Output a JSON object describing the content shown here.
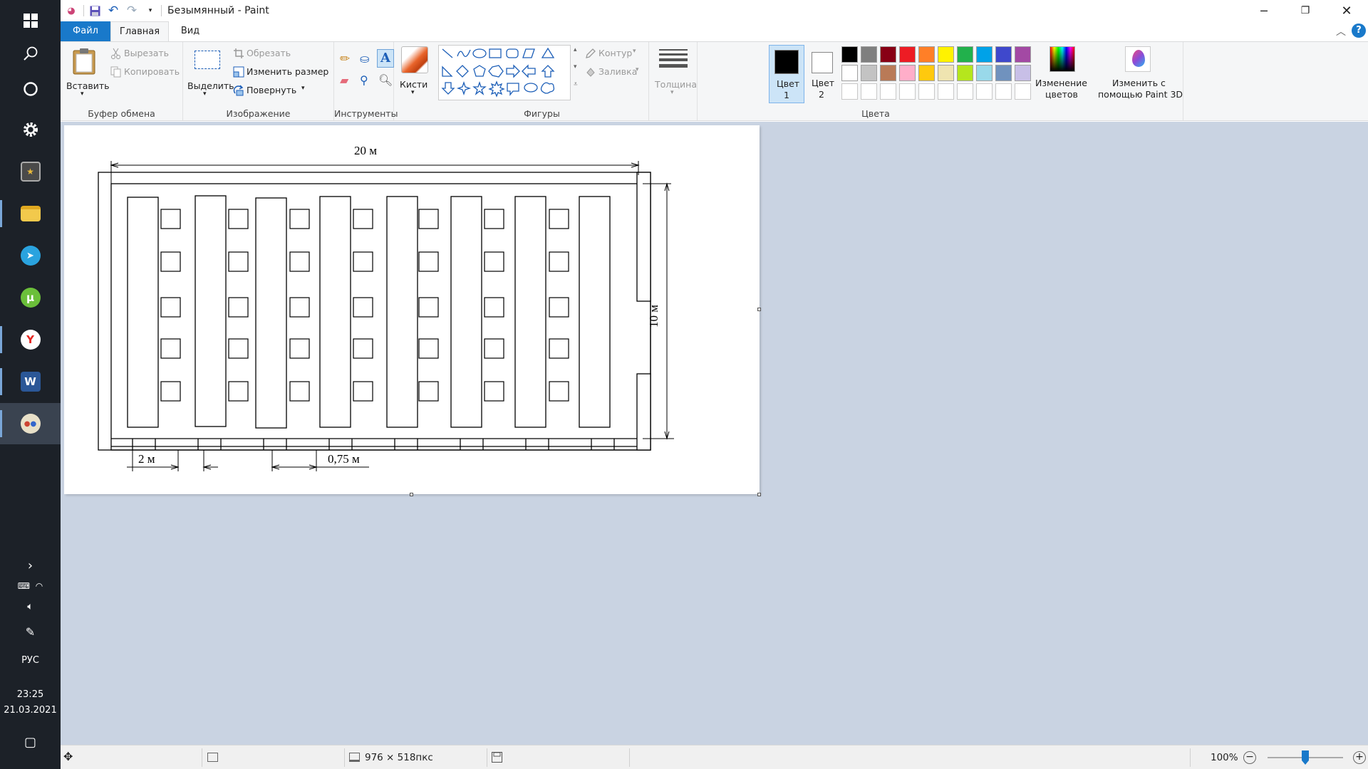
{
  "window": {
    "title": "Безымянный - Paint"
  },
  "tabs": {
    "file": "Файл",
    "home": "Главная",
    "view": "Вид"
  },
  "clipboard": {
    "paste": "Вставить",
    "cut": "Вырезать",
    "copy": "Копировать",
    "label": "Буфер обмена"
  },
  "image": {
    "select": "Выделить",
    "crop": "Обрезать",
    "resize": "Изменить размер",
    "rotate": "Повернуть",
    "label": "Изображение"
  },
  "tools": {
    "label": "Инструменты",
    "brushes": "Кисти"
  },
  "shapes": {
    "label": "Фигуры",
    "outline": "Контур",
    "fill": "Заливка"
  },
  "size": {
    "label": "Толщина"
  },
  "colors": {
    "color1_a": "Цвет",
    "color1_b": "1",
    "color2_a": "Цвет",
    "color2_b": "2",
    "edit_a": "Изменение",
    "edit_b": "цветов",
    "paint3d_a": "Изменить с",
    "paint3d_b": "помощью Paint 3D",
    "label": "Цвета",
    "palette_row1": [
      "#000000",
      "#7f7f7f",
      "#880015",
      "#ed1c24",
      "#ff7f27",
      "#fff200",
      "#22b14c",
      "#00a2e8",
      "#3f48cc",
      "#a349a4"
    ],
    "palette_row2": [
      "#ffffff",
      "#c3c3c3",
      "#b97a57",
      "#ffaec9",
      "#ffc90e",
      "#efe4b0",
      "#b5e61d",
      "#99d9ea",
      "#7092be",
      "#c8bfe7"
    ],
    "color1_value": "#000000",
    "color2_value": "#ffffff"
  },
  "drawing": {
    "dim_width": "20 м",
    "dim_height": "10 м",
    "dim_2m": "2 м",
    "dim_075": "0,75 м"
  },
  "status": {
    "dimensions": "976 × 518пкс",
    "zoom": "100%"
  },
  "taskbar": {
    "language": "РУС",
    "time": "23:25",
    "date": "21.03.2021"
  }
}
